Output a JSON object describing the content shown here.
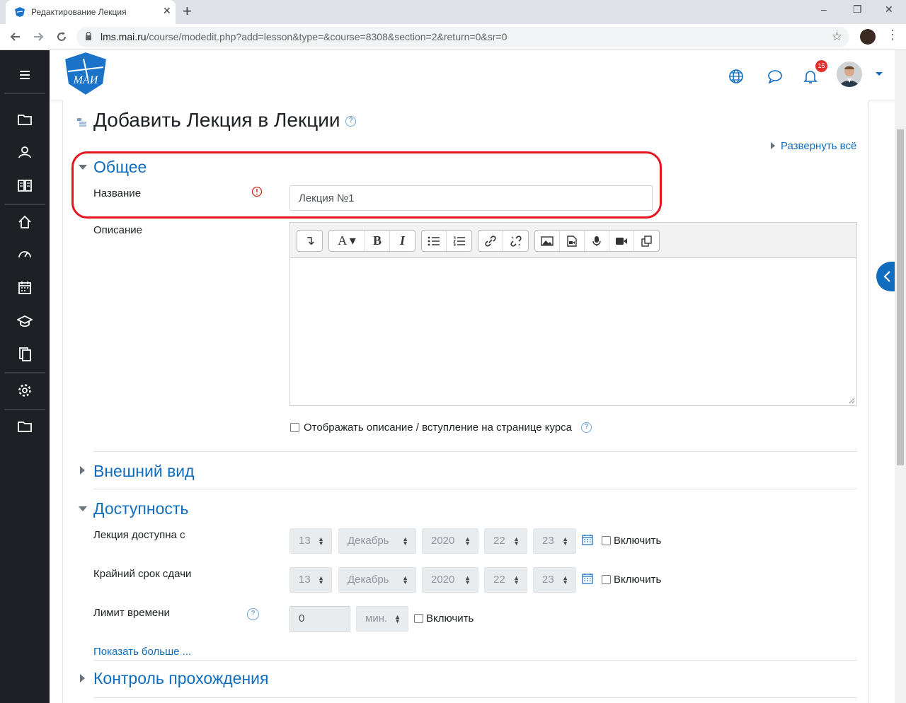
{
  "browser": {
    "tab_title": "Редактирование Лекция",
    "close_glyph": "✕",
    "new_tab_glyph": "+",
    "url_host": "lms.mai.ru",
    "url_path": "/course/modedit.php?add=lesson&type=&course=8308&section=2&return=0&sr=0",
    "minimize_glyph": "–",
    "restore_glyph": "❐",
    "close_window_glyph": "✕"
  },
  "sidebar_icons": [
    "folder-icon",
    "participants-icon",
    "grades-icon",
    "home-icon",
    "dashboard-icon",
    "calendar-icon",
    "courses-icon",
    "content-bank-icon",
    "settings-icon",
    "folder-icon"
  ],
  "navbar": {
    "notification_count": "15",
    "logo_text": "МАИ"
  },
  "page": {
    "heading": "Добавить Лекция в Лекции",
    "expand_all": "Развернуть всё",
    "sections": {
      "general": "Общее",
      "appearance": "Внешний вид",
      "availability": "Доступность",
      "flow_control": "Контроль прохождения"
    },
    "name_label": "Название",
    "name_value": "Лекция №1",
    "description_label": "Описание",
    "display_desc_label": "Отображать описание / вступление на странице курса",
    "available_from_label": "Лекция доступна с",
    "deadline_label": "Крайний срок сдачи",
    "time_limit_label": "Лимит времени",
    "date": {
      "day": "13",
      "month": "Декабрь",
      "year": "2020",
      "hour": "22",
      "minute": "23"
    },
    "enable_label": "Включить",
    "time_limit_value": "0",
    "time_unit": "мин.",
    "show_more": "Показать больше ..."
  },
  "colors": {
    "accent": "#0f6cbf",
    "drawer": "#1d2125",
    "highlight": "#e4151f"
  }
}
